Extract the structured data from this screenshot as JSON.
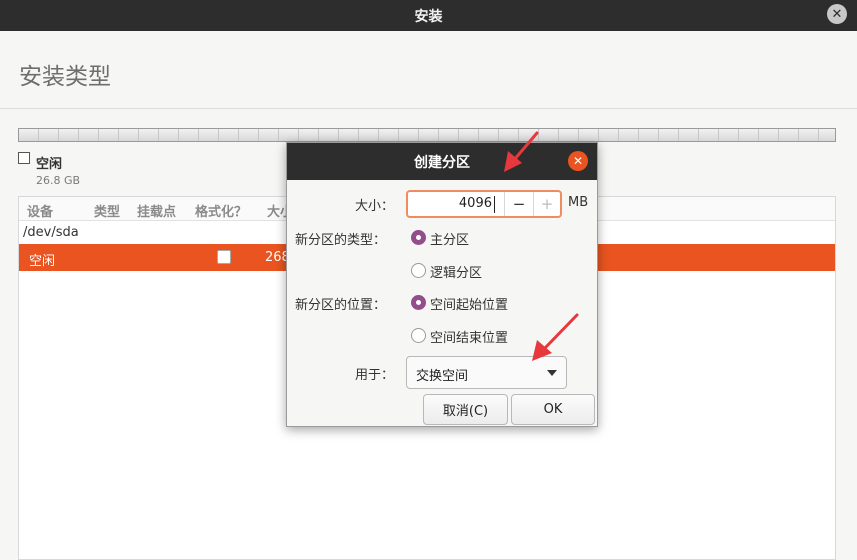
{
  "window": {
    "title": "安装",
    "close_glyph": "✕"
  },
  "page": {
    "title": "安装类型"
  },
  "partition_bar": {
    "legend_label": "空闲",
    "legend_size": "26.8 GB"
  },
  "table": {
    "headers": [
      "设备",
      "类型",
      "挂载点",
      "格式化？",
      "大小"
    ],
    "device": "/dev/sda",
    "free_row": {
      "device": "空闲",
      "size": "268"
    }
  },
  "dialog": {
    "title": "创建分区",
    "close_glyph": "✕",
    "size_label": "大小：",
    "size_value": "4096",
    "minus": "−",
    "plus": "+",
    "unit": "MB",
    "type_label": "新分区的类型：",
    "type_options": [
      "主分区",
      "逻辑分区"
    ],
    "type_selected": "主分区",
    "location_label": "新分区的位置：",
    "location_options": [
      "空间起始位置",
      "空间结束位置"
    ],
    "location_selected": "空间起始位置",
    "use_label": "用于：",
    "use_value": "交换空间",
    "cancel_label": "取消(C)",
    "ok_label": "OK"
  },
  "colors": {
    "accent": "#e95420",
    "radio": "#924d8b",
    "titlebar": "#2d2d2d",
    "annotation_arrow": "#e8383d"
  },
  "icons": {
    "window_close": "close-icon",
    "dialog_close": "close-icon",
    "dropdown": "chevron-down-icon"
  }
}
